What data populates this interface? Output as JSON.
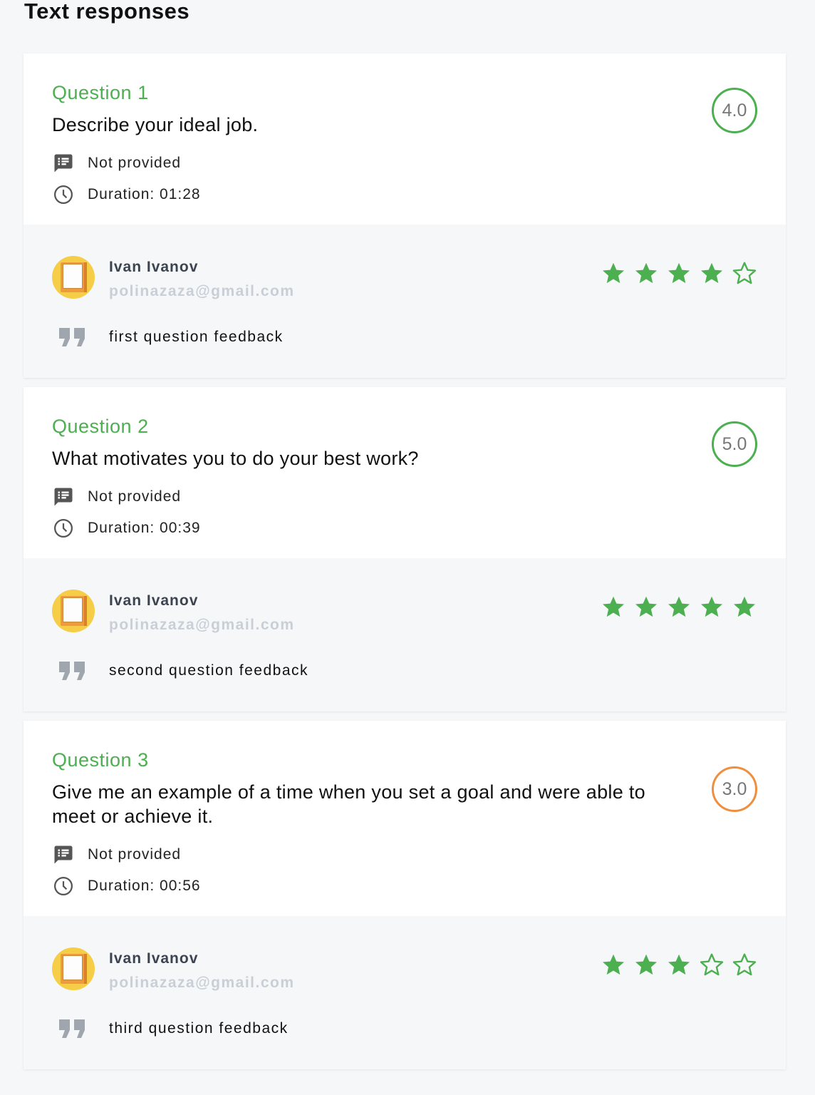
{
  "page": {
    "title": "Text responses"
  },
  "colors": {
    "accent_green": "#4caf50",
    "score_orange": "#ef8f3e",
    "email_gray": "#c9cfd6"
  },
  "questions": [
    {
      "label": "Question 1",
      "text": "Describe your ideal job.",
      "notes": "Not provided",
      "duration": "Duration: 01:28",
      "score": "4.0",
      "score_color": "green",
      "review": {
        "name": "Ivan Ivanov",
        "email": "polinazaza@gmail.com",
        "rating": 4,
        "rating_max": 5,
        "feedback": "first question feedback"
      }
    },
    {
      "label": "Question 2",
      "text": "What motivates you to do your best work?",
      "notes": "Not provided",
      "duration": "Duration: 00:39",
      "score": "5.0",
      "score_color": "green",
      "review": {
        "name": "Ivan Ivanov",
        "email": "polinazaza@gmail.com",
        "rating": 5,
        "rating_max": 5,
        "feedback": "second question feedback"
      }
    },
    {
      "label": "Question 3",
      "text": "Give me an example of a time when you set a goal and were able to meet or achieve it.",
      "notes": "Not provided",
      "duration": "Duration: 00:56",
      "score": "3.0",
      "score_color": "orange",
      "review": {
        "name": "Ivan Ivanov",
        "email": "polinazaza@gmail.com",
        "rating": 3,
        "rating_max": 5,
        "feedback": "third question feedback"
      }
    }
  ],
  "icons": {
    "notes": "notes-list-icon",
    "duration": "clock-icon",
    "quote": "quote-icon",
    "star_filled": "star-filled-icon",
    "star_empty": "star-outline-icon"
  }
}
